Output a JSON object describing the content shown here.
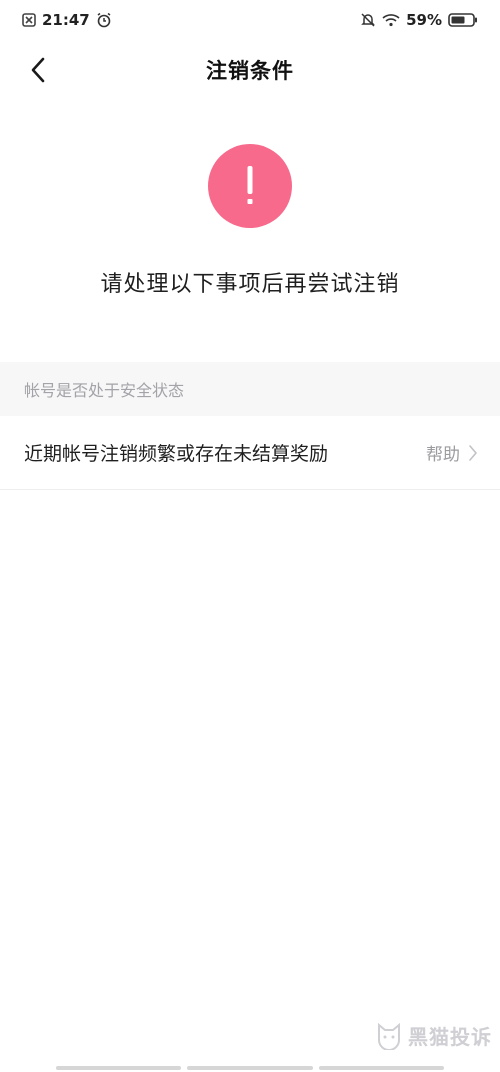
{
  "status_bar": {
    "time": "21:47",
    "battery": "59%"
  },
  "nav": {
    "title": "注销条件"
  },
  "alert": {
    "symbol": "!"
  },
  "notice": {
    "text": "请处理以下事项后再尝试注销"
  },
  "section": {
    "header": "帐号是否处于安全状态"
  },
  "items": [
    {
      "label": "近期帐号注销频繁或存在未结算奖励",
      "action": "帮助"
    }
  ],
  "watermark": {
    "text": "黑猫投诉"
  },
  "colors": {
    "alert": "#f76a8c",
    "section_bg": "#f7f7f8",
    "muted_text": "#9b9ba0"
  }
}
